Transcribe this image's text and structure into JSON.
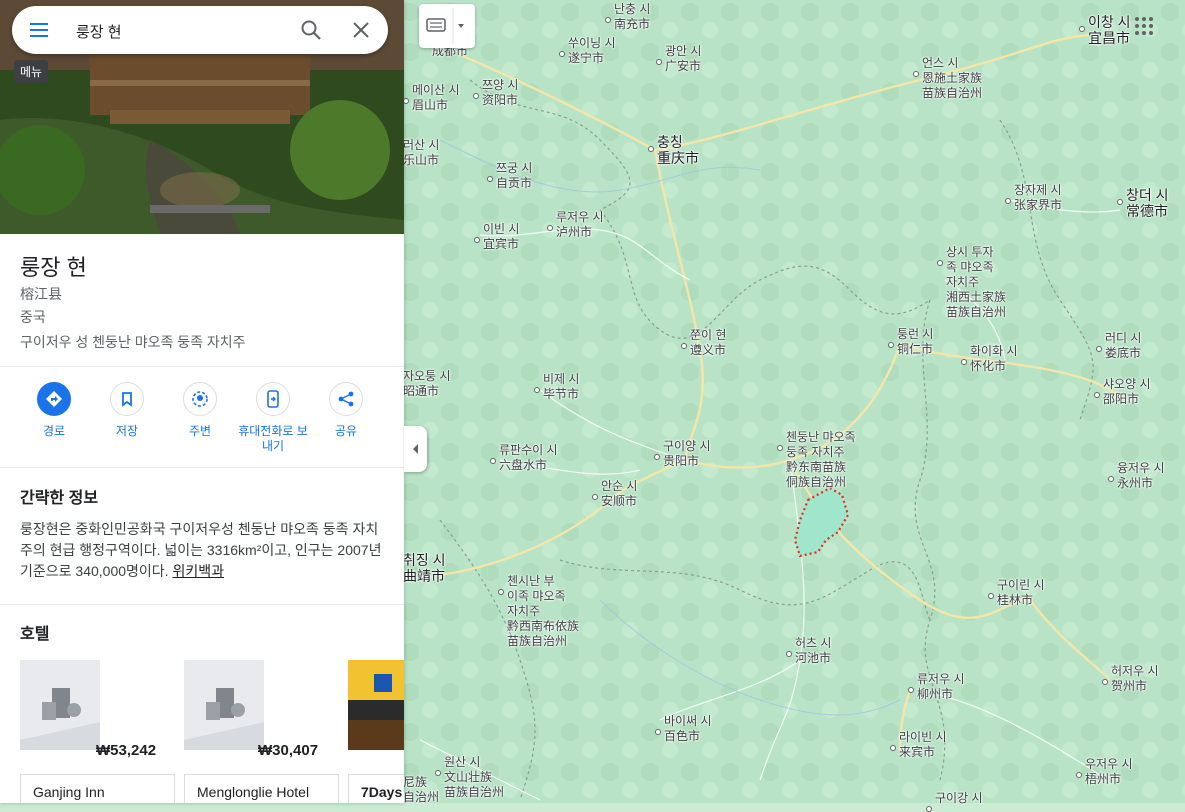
{
  "search": {
    "query": "룽장 현"
  },
  "tooltip": {
    "menu": "메뉴"
  },
  "place": {
    "title": "룽장 현",
    "native_name": "榕江县",
    "country": "중국",
    "region": "구이저우 성 첸둥난 먀오족 둥족 자치주"
  },
  "actions": [
    {
      "label": "경로",
      "icon": "directions-icon"
    },
    {
      "label": "저장",
      "icon": "bookmark-icon"
    },
    {
      "label": "주변",
      "icon": "nearby-icon"
    },
    {
      "label": "휴대전화로 보\n내기",
      "icon": "send-to-phone-icon"
    },
    {
      "label": "공유",
      "icon": "share-icon"
    }
  ],
  "info": {
    "heading": "간략한 정보",
    "text": "룽장현은 중화인민공화국 구이저우성 첸둥난 먀오족 둥족 자치주의 현급 행정구역이다. 넓이는 3316km²이고, 인구는 2007년 기준으로 340,000명이다. ",
    "link": "위키백과"
  },
  "hotels": {
    "heading": "호텔",
    "items": [
      {
        "name": "Ganjing Inn",
        "price": "₩53,242"
      },
      {
        "name": "Menglonglie Hotel",
        "price": "₩30,407"
      },
      {
        "name": "7Days",
        "price": ""
      }
    ]
  },
  "map": {
    "cities": [
      {
        "t": "난충 시",
        "c": "南充市"
      },
      {
        "t": "쑤이닝 시",
        "c": "遂宁市"
      },
      {
        "t": "광안 시",
        "c": "广安市"
      },
      {
        "t": "成都市",
        "c": ""
      },
      {
        "t": "메이산 시",
        "c": "眉山市"
      },
      {
        "t": "쯔양 시",
        "c": "资阳市"
      },
      {
        "t": "러산 시",
        "c": "乐山市"
      },
      {
        "t": "충칭",
        "c": "重庆市"
      },
      {
        "t": "쯔궁 시",
        "c": "自贡市"
      },
      {
        "t": "루저우 시",
        "c": "泸州市"
      },
      {
        "t": "이빈 시",
        "c": "宜宾市"
      },
      {
        "t": "쭌이 현",
        "c": "遵义市"
      },
      {
        "t": "자오퉁 시",
        "c": "昭通市"
      },
      {
        "t": "비제 시",
        "c": "毕节市"
      },
      {
        "t": "류판수이 시",
        "c": "六盘水市"
      },
      {
        "t": "구이양 시",
        "c": "贵阳市"
      },
      {
        "t": "안순 시",
        "c": "安顺市"
      },
      {
        "t": "취징 시",
        "c": "曲靖市"
      },
      {
        "t": "첸시난 부\n이족 먀오족\n자치주",
        "c": "黔西南布依族\n苗族自治州"
      },
      {
        "t": "바이써 시",
        "c": "百色市"
      },
      {
        "t": "원산 시",
        "c": "文山壮族\n苗族自治州"
      },
      {
        "t": "첸둥난 먀오족\n둥족 자치주",
        "c": "黔东南苗族\n侗族自治州"
      },
      {
        "t": "허츠 시",
        "c": "河池市"
      },
      {
        "t": "류저우 시",
        "c": "柳州市"
      },
      {
        "t": "라이빈 시",
        "c": "来宾市"
      },
      {
        "t": "구이린 시",
        "c": "桂林市"
      },
      {
        "t": "허저우 시",
        "c": "贺州市"
      },
      {
        "t": "우저우 시",
        "c": "梧州市"
      },
      {
        "t": "구이강 시",
        "c": ""
      },
      {
        "t": "퉁런 시",
        "c": "铜仁市"
      },
      {
        "t": "화이화 시",
        "c": "怀化市"
      },
      {
        "t": "샤오양 시",
        "c": "邵阳市"
      },
      {
        "t": "융저우 시",
        "c": "永州市"
      },
      {
        "t": "러디 시",
        "c": "娄底市"
      },
      {
        "t": "상시 투자\n족 먀오족\n자치주",
        "c": "湘西土家族\n苗族自治州"
      },
      {
        "t": "장자제 시",
        "c": "张家界市"
      },
      {
        "t": "창더 시",
        "c": "常德市"
      },
      {
        "t": "언스 시",
        "c": "恩施土家族\n苗族自治州"
      },
      {
        "t": "이창 시",
        "c": "宜昌市"
      },
      {
        "t": "尼族",
        "c": "自治州"
      }
    ]
  },
  "colors": {
    "accent": "#1a73e8",
    "map_bg": "#b9e3c6",
    "border_red": "#d93025"
  }
}
